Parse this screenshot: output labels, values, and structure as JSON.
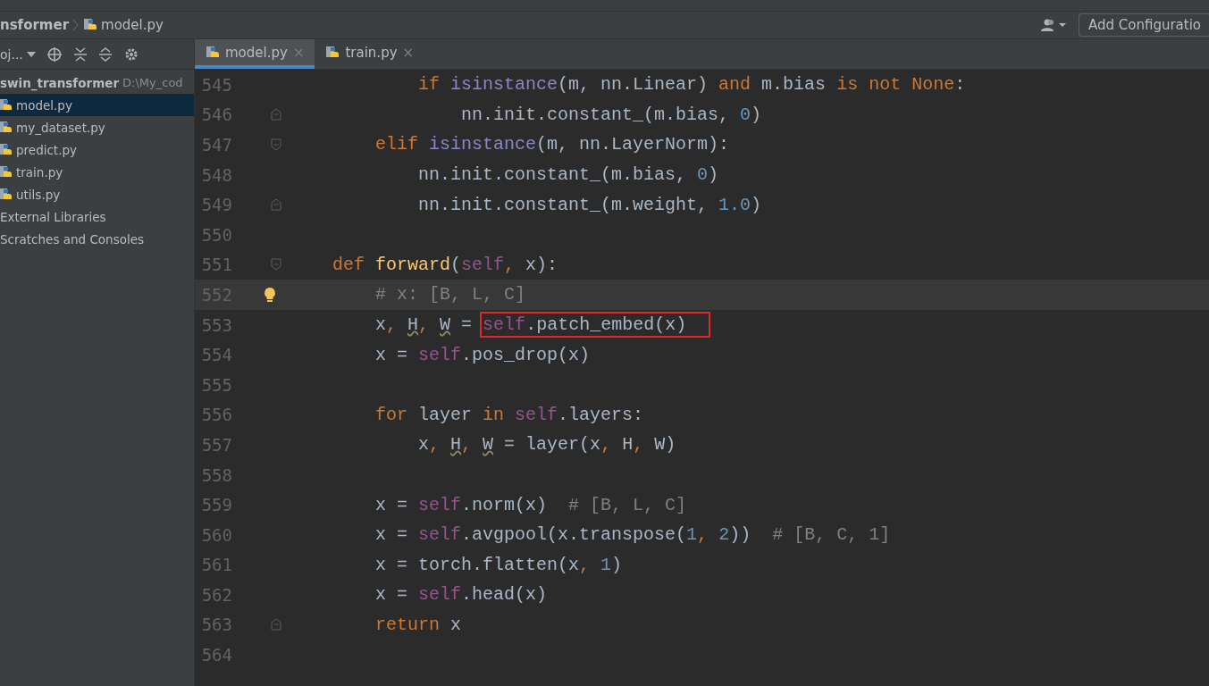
{
  "navigation_bar": {
    "breadcrumbs": [
      "nsformer",
      "model.py"
    ],
    "add_configuration": "Add Configuratio"
  },
  "project_panel": {
    "title": "oj...",
    "tree": [
      {
        "label": "swin_transformer",
        "path": "D:\\My_cod",
        "kind": "folder",
        "selected": false,
        "children": [
          {
            "label": "model.py",
            "kind": "python",
            "selected": true
          },
          {
            "label": "my_dataset.py",
            "kind": "python",
            "selected": false
          },
          {
            "label": "predict.py",
            "kind": "python",
            "selected": false
          },
          {
            "label": "train.py",
            "kind": "python",
            "selected": false
          },
          {
            "label": "utils.py",
            "kind": "python",
            "selected": false
          }
        ]
      },
      {
        "label": "External Libraries",
        "kind": "library",
        "selected": false
      },
      {
        "label": "Scratches and Consoles",
        "kind": "scratch",
        "selected": false
      }
    ]
  },
  "tabs": [
    {
      "label": "model.py",
      "close": "×",
      "selected": true
    },
    {
      "label": "train.py",
      "close": "×",
      "selected": false
    }
  ],
  "editor": {
    "lines": [
      {
        "number": "545",
        "fold_open": false,
        "fold_close": false,
        "current": false,
        "bulb": false,
        "code": [
          {
            "kind": "kw",
            "text": "            if"
          },
          {
            "kind": "builtin",
            "text": " isinstance"
          },
          {
            "kind": "plain",
            "text": "(m, nn.Linear) "
          },
          {
            "kind": "kw",
            "text": "and"
          },
          {
            "kind": "plain",
            "text": " m.bias "
          },
          {
            "kind": "kw",
            "text": "is not None"
          },
          {
            "kind": "plain",
            "text": ":"
          }
        ]
      },
      {
        "number": "546",
        "fold_open": false,
        "fold_close": true,
        "current": false,
        "bulb": false,
        "code": [
          {
            "kind": "plain",
            "text": "                nn.init.constant_(m.bias, "
          },
          {
            "kind": "num",
            "text": "0"
          },
          {
            "kind": "plain",
            "text": ")"
          }
        ]
      },
      {
        "number": "547",
        "fold_open": true,
        "fold_close": false,
        "current": false,
        "bulb": false,
        "code": [
          {
            "kind": "kw",
            "text": "        elif"
          },
          {
            "kind": "builtin",
            "text": " isinstance"
          },
          {
            "kind": "plain",
            "text": "(m, nn.LayerNorm):"
          }
        ]
      },
      {
        "number": "548",
        "fold_open": false,
        "fold_close": false,
        "current": false,
        "bulb": false,
        "code": [
          {
            "kind": "plain",
            "text": "            nn.init.constant_(m.bias, "
          },
          {
            "kind": "num",
            "text": "0"
          },
          {
            "kind": "plain",
            "text": ")"
          }
        ]
      },
      {
        "number": "549",
        "fold_open": false,
        "fold_close": true,
        "current": false,
        "bulb": false,
        "code": [
          {
            "kind": "plain",
            "text": "            nn.init.constant_(m.weight, "
          },
          {
            "kind": "num",
            "text": "1.0"
          },
          {
            "kind": "plain",
            "text": ")"
          }
        ]
      },
      {
        "number": "550",
        "fold_open": false,
        "fold_close": false,
        "current": false,
        "bulb": false
      },
      {
        "number": "551",
        "fold_open": true,
        "fold_close": false,
        "current": false,
        "bulb": false,
        "code": [
          {
            "kind": "kw",
            "text": "    def"
          },
          {
            "kind": "fn",
            "text": " forward"
          },
          {
            "kind": "plain",
            "text": "("
          },
          {
            "kind": "self",
            "text": "self"
          },
          {
            "kind": "kw",
            "text": ","
          },
          {
            "kind": "plain",
            "text": " x):"
          }
        ]
      },
      {
        "number": "552",
        "fold_open": false,
        "fold_close": false,
        "current": true,
        "bulb": true,
        "code": [
          {
            "kind": "comment",
            "text": "        # x: [B, L, C]"
          }
        ]
      },
      {
        "number": "553",
        "fold_open": false,
        "fold_close": false,
        "current": false,
        "bulb": false,
        "code": [
          {
            "kind": "plain",
            "text": "        x"
          },
          {
            "kind": "kw",
            "text": ", "
          },
          {
            "kind": "warn",
            "text": "H"
          },
          {
            "kind": "kw",
            "text": ", "
          },
          {
            "kind": "warn",
            "text": "W"
          },
          {
            "kind": "plain",
            "text": " = "
          },
          {
            "kind": "box",
            "parts": [
              {
                "kind": "self",
                "text": "self"
              },
              {
                "kind": "plain",
                "text": ".patch_embed(x)"
              }
            ]
          }
        ]
      },
      {
        "number": "554",
        "fold_open": false,
        "fold_close": false,
        "current": false,
        "bulb": false,
        "code": [
          {
            "kind": "plain",
            "text": "        x = "
          },
          {
            "kind": "self",
            "text": "self"
          },
          {
            "kind": "plain",
            "text": ".pos_drop(x)"
          }
        ]
      },
      {
        "number": "555",
        "fold_open": false,
        "fold_close": false,
        "current": false,
        "bulb": false
      },
      {
        "number": "556",
        "fold_open": false,
        "fold_close": false,
        "current": false,
        "bulb": false,
        "code": [
          {
            "kind": "kw",
            "text": "        for"
          },
          {
            "kind": "plain",
            "text": " layer "
          },
          {
            "kind": "kw",
            "text": "in"
          },
          {
            "kind": "self",
            "text": " self"
          },
          {
            "kind": "plain",
            "text": ".layers:"
          }
        ]
      },
      {
        "number": "557",
        "fold_open": false,
        "fold_close": false,
        "current": false,
        "bulb": false,
        "code": [
          {
            "kind": "plain",
            "text": "            x"
          },
          {
            "kind": "kw",
            "text": ", "
          },
          {
            "kind": "warn",
            "text": "H"
          },
          {
            "kind": "kw",
            "text": ", "
          },
          {
            "kind": "warn",
            "text": "W"
          },
          {
            "kind": "plain",
            "text": " = layer(x"
          },
          {
            "kind": "kw",
            "text": ","
          },
          {
            "kind": "plain",
            "text": " H"
          },
          {
            "kind": "kw",
            "text": ","
          },
          {
            "kind": "plain",
            "text": " W)"
          }
        ]
      },
      {
        "number": "558",
        "fold_open": false,
        "fold_close": false,
        "current": false,
        "bulb": false
      },
      {
        "number": "559",
        "fold_open": false,
        "fold_close": false,
        "current": false,
        "bulb": false,
        "code": [
          {
            "kind": "plain",
            "text": "        x = "
          },
          {
            "kind": "self",
            "text": "self"
          },
          {
            "kind": "plain",
            "text": ".norm(x)"
          },
          {
            "kind": "comment",
            "text": "  # [B, L, C]"
          }
        ]
      },
      {
        "number": "560",
        "fold_open": false,
        "fold_close": false,
        "current": false,
        "bulb": false,
        "code": [
          {
            "kind": "plain",
            "text": "        x = "
          },
          {
            "kind": "self",
            "text": "self"
          },
          {
            "kind": "plain",
            "text": ".avgpool(x.transpose("
          },
          {
            "kind": "num",
            "text": "1"
          },
          {
            "kind": "kw",
            "text": ", "
          },
          {
            "kind": "num",
            "text": "2"
          },
          {
            "kind": "plain",
            "text": "))"
          },
          {
            "kind": "comment",
            "text": "  # [B, C, 1]"
          }
        ]
      },
      {
        "number": "561",
        "fold_open": false,
        "fold_close": false,
        "current": false,
        "bulb": false,
        "code": [
          {
            "kind": "plain",
            "text": "        x = torch.flatten(x"
          },
          {
            "kind": "kw",
            "text": ", "
          },
          {
            "kind": "num",
            "text": "1"
          },
          {
            "kind": "plain",
            "text": ")"
          }
        ]
      },
      {
        "number": "562",
        "fold_open": false,
        "fold_close": false,
        "current": false,
        "bulb": false,
        "code": [
          {
            "kind": "plain",
            "text": "        x = "
          },
          {
            "kind": "self",
            "text": "self"
          },
          {
            "kind": "plain",
            "text": ".head(x)"
          }
        ]
      },
      {
        "number": "563",
        "fold_open": false,
        "fold_close": true,
        "current": false,
        "bulb": false,
        "code": [
          {
            "kind": "kw",
            "text": "        return"
          },
          {
            "kind": "plain",
            "text": " x"
          }
        ]
      },
      {
        "number": "564",
        "fold_open": false,
        "fold_close": false,
        "current": false,
        "bulb": false
      }
    ]
  }
}
